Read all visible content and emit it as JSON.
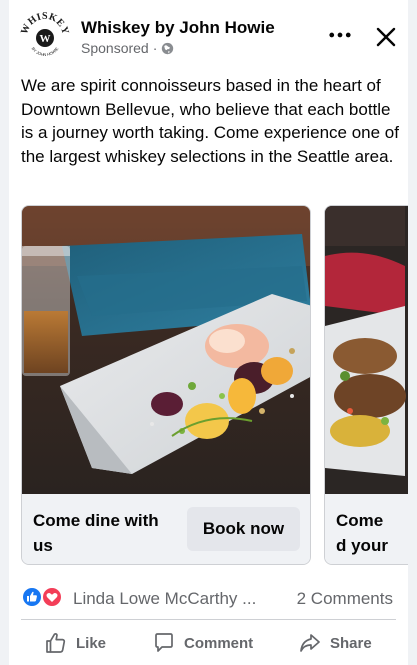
{
  "header": {
    "page_name": "Whiskey by John Howie",
    "sponsored_label": "Sponsored",
    "separator": "·",
    "logo_text": "WHISKEY",
    "logo_subtext": "BY JOHN HOWIE",
    "logo_letter": "W",
    "icons": {
      "more": "more-horizontal-icon",
      "close": "close-icon",
      "audience": "globe-icon"
    }
  },
  "post": {
    "text": "We are spirit connoisseurs based in the heart of Downtown Bellevue, who believe that each bottle is a journey worth taking. Come experience one of the largest whiskey selections in the Seattle area."
  },
  "carousel": {
    "slides": [
      {
        "title": "Come dine with us",
        "cta": "Book now"
      },
      {
        "title": "Come d your ne",
        "cta": ""
      }
    ]
  },
  "reactions": {
    "types": [
      "like",
      "love"
    ],
    "reactors_text": "Linda Lowe McCarthy ...",
    "comments_text": "2 Comments"
  },
  "actions": {
    "like_label": "Like",
    "comment_label": "Comment",
    "share_label": "Share"
  },
  "colors": {
    "primary_text": "#050505",
    "secondary_text": "#65676b",
    "like_blue": "#1877f2",
    "love_red": "#f33e58",
    "button_bg": "#e4e6eb",
    "footer_bg": "#f0f2f5"
  }
}
